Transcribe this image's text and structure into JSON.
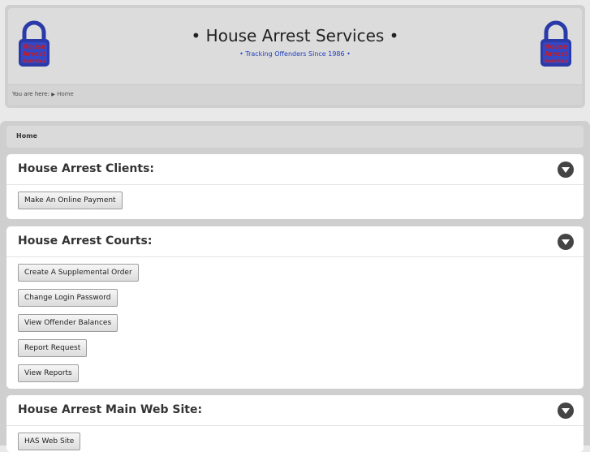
{
  "header": {
    "title": "• House Arrest Services •",
    "subtitle": "• Tracking Offenders Since 1986 •",
    "logo_text": "House Arrest Services"
  },
  "breadcrumb": {
    "prefix": "You are here:",
    "separator": "▶",
    "current": "Home"
  },
  "page": {
    "title": "Home"
  },
  "panels": [
    {
      "title": "House Arrest Clients:",
      "buttons": [
        "Make An Online Payment"
      ]
    },
    {
      "title": "House Arrest Courts:",
      "buttons": [
        "Create A Supplemental Order",
        "Change Login Password",
        "View Offender Balances",
        "Report Request",
        "View Reports"
      ]
    },
    {
      "title": "House Arrest Main Web Site:",
      "buttons": [
        "HAS Web Site"
      ]
    }
  ],
  "colors": {
    "accent_blue": "#1f3fbf",
    "lock_red": "#cc1a1a",
    "lock_blue": "#2a3aa8"
  }
}
